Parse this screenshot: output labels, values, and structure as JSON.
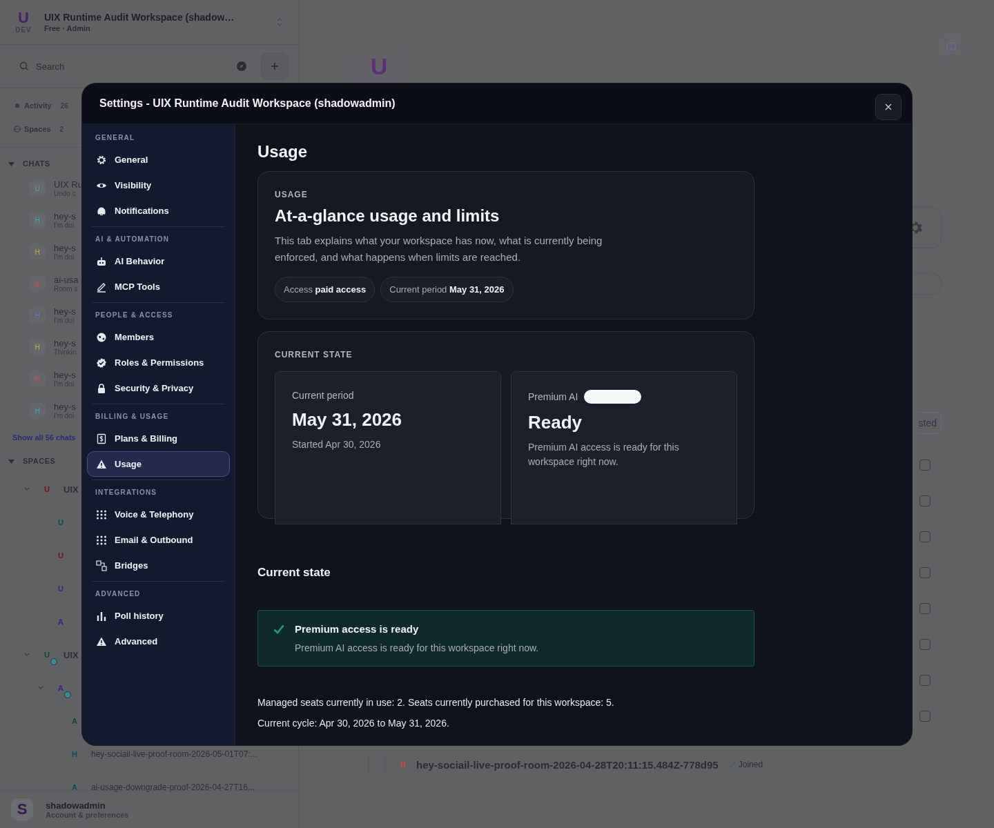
{
  "app": {
    "workspace": {
      "logo": "U",
      "badge": "DEV",
      "title": "UIX Runtime Audit Workspace (shadow…",
      "subtitle": "Free · Admin"
    },
    "search": {
      "placeholder": "Search"
    },
    "nav": [
      {
        "label": "Activity",
        "count": "26"
      },
      {
        "label": "Spaces",
        "count": "2"
      }
    ],
    "chats": {
      "title": "CHATS",
      "expanded": true,
      "show_all": "Show all 56 chats",
      "items": [
        {
          "avatar": "U",
          "color": "#3fa7b5",
          "name": "UIX Ru",
          "preview": "Undo c"
        },
        {
          "avatar": "H",
          "color": "#35a9c9",
          "name": "hey-s",
          "preview": "I'm doi"
        },
        {
          "avatar": "H",
          "color": "#c9a03a",
          "name": "hey-s",
          "preview": "I'm doi"
        },
        {
          "avatar": "A",
          "color": "#d9434a",
          "name": "ai-usa",
          "preview": "Room s"
        },
        {
          "avatar": "H",
          "color": "#6a6fd6",
          "name": "hey-s",
          "preview": "I'm doi"
        },
        {
          "avatar": "H",
          "color": "#c9b23a",
          "name": "hey-s",
          "preview": "Thinkin"
        },
        {
          "avatar": "H",
          "color": "#d9434a",
          "name": "hey-s",
          "preview": "I'm doi"
        },
        {
          "avatar": "H",
          "color": "#35a9c9",
          "name": "hey-s",
          "preview": "I'm doi"
        }
      ]
    },
    "spaces": {
      "title": "SPACES",
      "expanded": true,
      "tree": [
        {
          "avatar": "U",
          "color": "#7a1016",
          "label": "UIX",
          "expanded": true,
          "children": [
            {
              "avatar": "U",
              "color": "#0e4a52"
            },
            {
              "avatar": "U",
              "color": "#7a1016"
            },
            {
              "avatar": "U",
              "color": "#3a2090"
            },
            {
              "avatar": "A",
              "color": "#3a2090"
            }
          ]
        },
        {
          "avatar": "U",
          "color": "#0e4a28",
          "label": "UIX",
          "expanded": true,
          "dot": true,
          "children": [
            {
              "avatar": "A",
              "color": "#3a2090",
              "expanded": true,
              "dot": true,
              "children": [
                {
                  "avatar": "A",
                  "color": "#0e4a28"
                },
                {
                  "avatar": "H",
                  "color": "#0c4a60",
                  "label": "hey-sociail-live-proof-room-2026-05-01T07:..."
                },
                {
                  "avatar": "A",
                  "color": "#0c4a60",
                  "label": "ai-usage-downgrade-proof-2026-04-27T16..."
                }
              ]
            }
          ]
        }
      ]
    },
    "user": {
      "avatar": "S",
      "name": "shadowadmin",
      "subtitle": "Account & preferences"
    }
  },
  "main": {
    "logo": "U",
    "filter_button": "sted",
    "checkboxes": [
      {
        "checked": false
      },
      {
        "checked": false
      },
      {
        "checked": false
      },
      {
        "checked": false
      },
      {
        "checked": false
      },
      {
        "checked": false
      },
      {
        "checked": false
      },
      {
        "checked": false
      }
    ],
    "room": {
      "avatar": "H",
      "color": "#d9434a",
      "name": "hey-sociail-live-proof-room-2026-04-28T20:11:15.484Z-778d95",
      "status": "Joined"
    }
  },
  "settings": {
    "title": "Settings - UIX Runtime Audit Workspace (shadowadmin)",
    "sections": [
      {
        "title": "GENERAL",
        "items": [
          {
            "label": "General",
            "selected": false
          },
          {
            "label": "Visibility",
            "selected": false
          },
          {
            "label": "Notifications",
            "selected": false
          }
        ]
      },
      {
        "title": "AI & AUTOMATION",
        "items": [
          {
            "label": "AI Behavior",
            "selected": false
          },
          {
            "label": "MCP Tools",
            "selected": false
          }
        ]
      },
      {
        "title": "PEOPLE & ACCESS",
        "items": [
          {
            "label": "Members",
            "selected": false
          },
          {
            "label": "Roles & Permissions",
            "selected": false
          },
          {
            "label": "Security & Privacy",
            "selected": false
          }
        ]
      },
      {
        "title": "BILLING & USAGE",
        "items": [
          {
            "label": "Plans & Billing",
            "selected": false
          },
          {
            "label": "Usage",
            "selected": true
          }
        ]
      },
      {
        "title": "INTEGRATIONS",
        "items": [
          {
            "label": "Voice & Telephony",
            "selected": false
          },
          {
            "label": "Email & Outbound",
            "selected": false
          },
          {
            "label": "Bridges",
            "selected": false
          }
        ]
      },
      {
        "title": "ADVANCED",
        "items": [
          {
            "label": "Poll history",
            "selected": false
          },
          {
            "label": "Advanced",
            "selected": false
          }
        ]
      }
    ],
    "page": {
      "title": "Usage",
      "overview": {
        "eyebrow": "USAGE",
        "heading": "At-a-glance usage and limits",
        "description": "This tab explains what your workspace has now, what is currently being enforced, and what happens when limits are reached.",
        "chips": [
          {
            "label": "Access",
            "value": "paid access"
          },
          {
            "label": "Current period",
            "value": "May 31, 2026"
          }
        ]
      },
      "current_state": {
        "eyebrow": "CURRENT STATE",
        "cards": [
          {
            "label": "Current period",
            "badge": false,
            "value": "May 31, 2026",
            "note": "Started Apr 30, 2026"
          },
          {
            "label": "Premium AI",
            "badge": true,
            "value": "Ready",
            "note": "Premium AI access is ready for this workspace right now."
          }
        ]
      },
      "status_heading": "Current state",
      "alert": {
        "kind": "success",
        "title": "Premium access is ready",
        "message": "Premium AI access is ready for this workspace right now."
      },
      "details": [
        "Managed seats currently in use: 2. Seats currently purchased for this workspace: 5.",
        "Current cycle: Apr 30, 2026 to May 31, 2026."
      ]
    }
  }
}
